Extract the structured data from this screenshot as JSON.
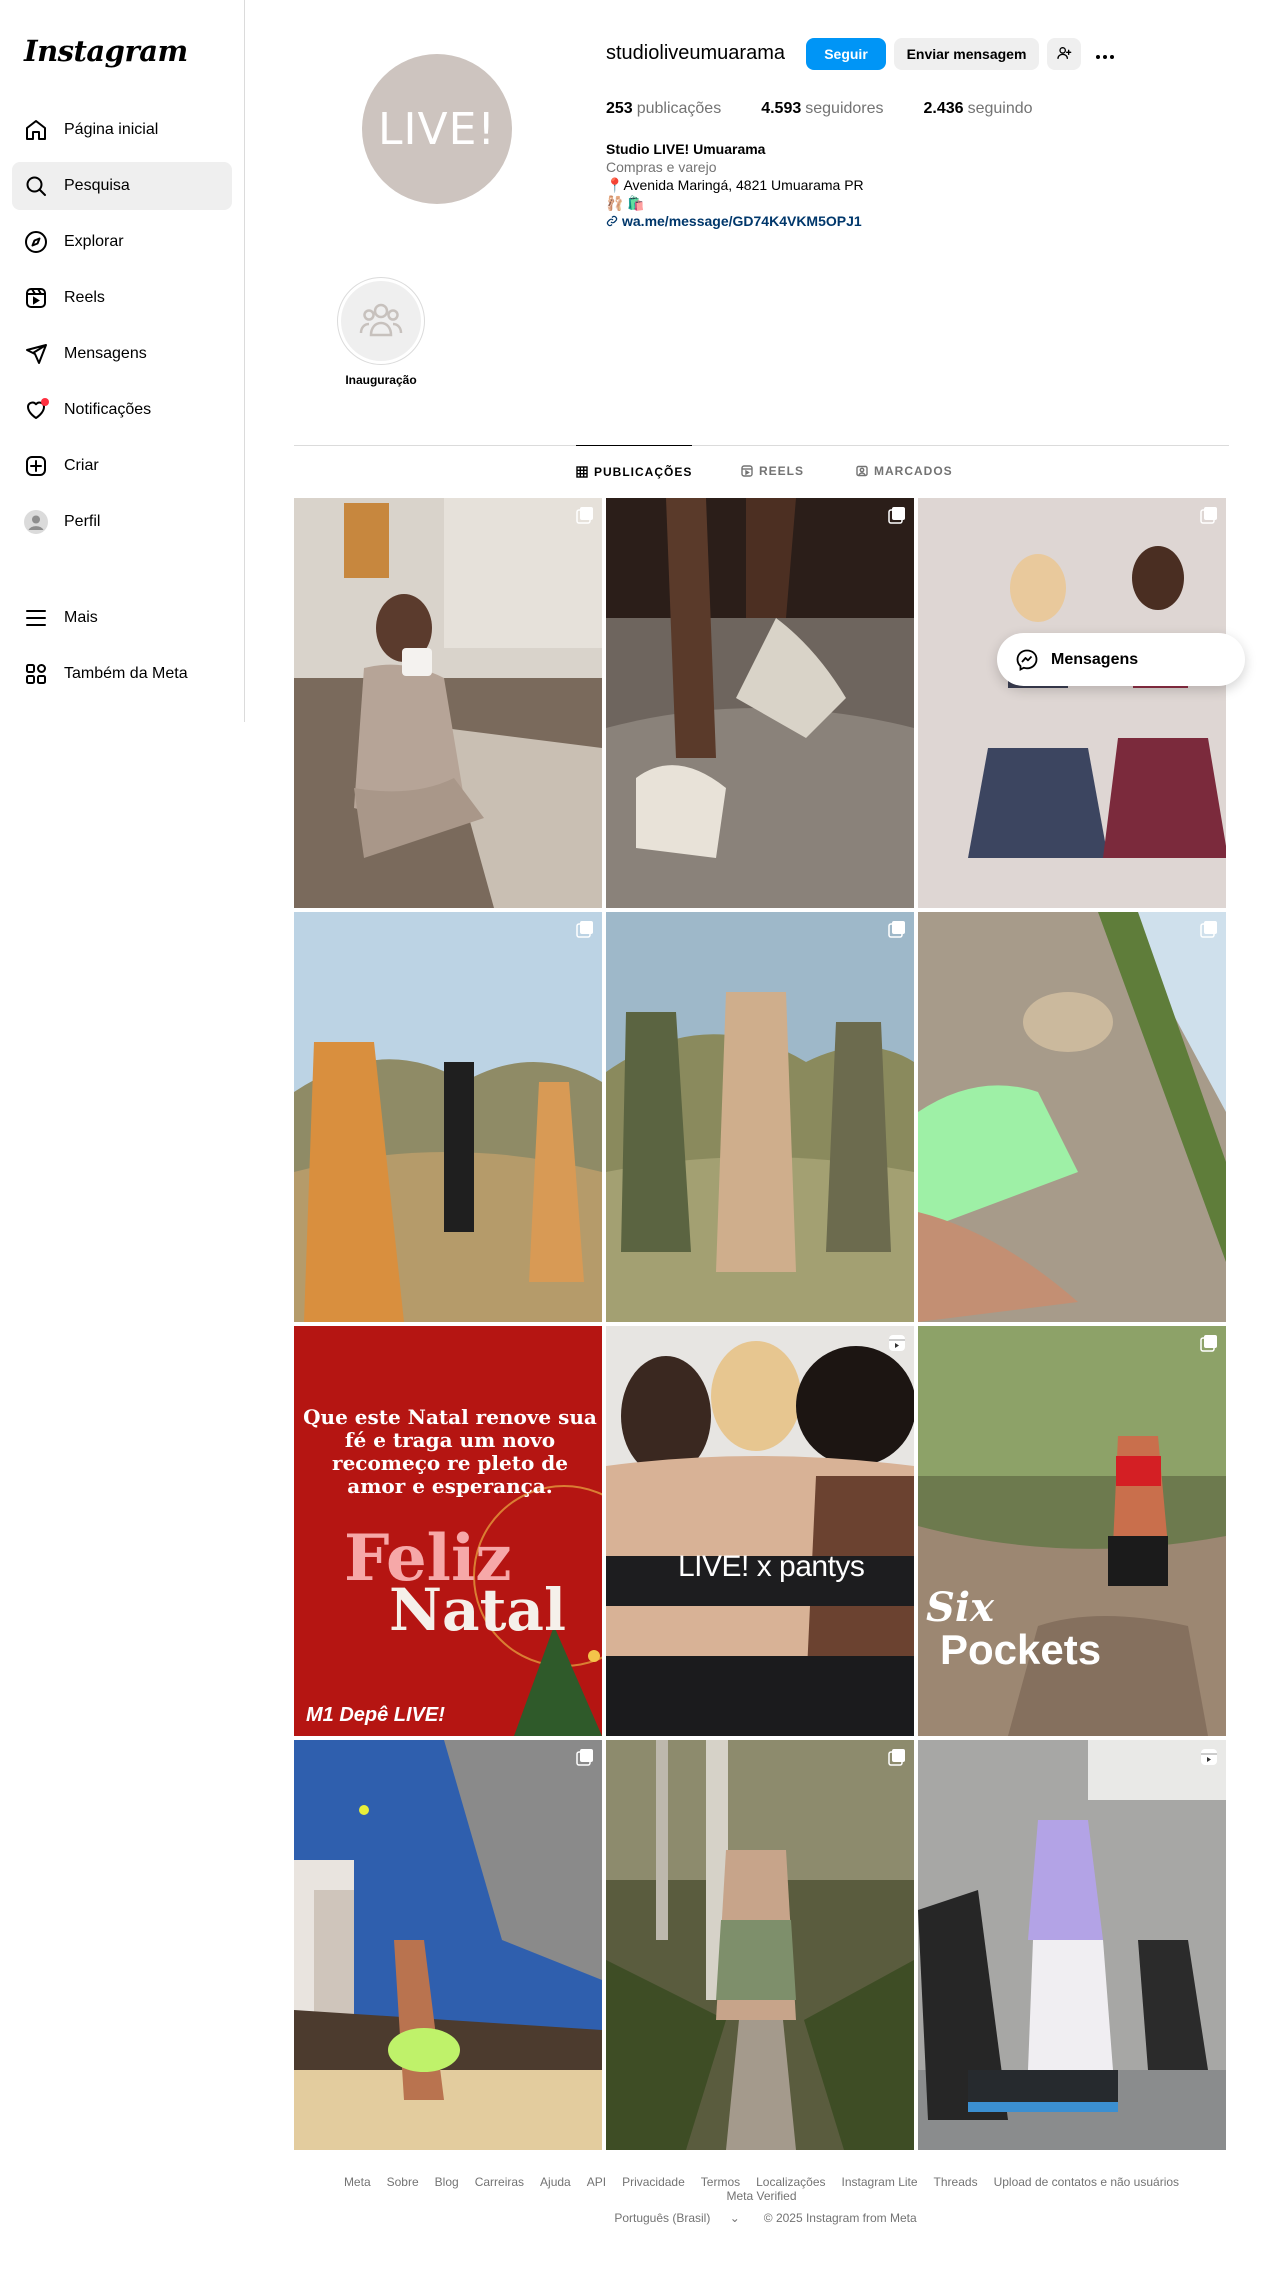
{
  "app": {
    "logo": "Instagram"
  },
  "sidebar": {
    "items": [
      {
        "label": "Página inicial",
        "icon": "home-icon"
      },
      {
        "label": "Pesquisa",
        "icon": "search-icon",
        "active": true
      },
      {
        "label": "Explorar",
        "icon": "compass-icon"
      },
      {
        "label": "Reels",
        "icon": "reels-icon"
      },
      {
        "label": "Mensagens",
        "icon": "send-icon"
      },
      {
        "label": "Notificações",
        "icon": "heart-icon"
      },
      {
        "label": "Criar",
        "icon": "plus-square-icon"
      },
      {
        "label": "Perfil",
        "icon": "profile-avatar"
      }
    ],
    "more": [
      {
        "label": "Mais",
        "icon": "menu-icon"
      },
      {
        "label": "Também da Meta",
        "icon": "meta-apps-icon"
      }
    ]
  },
  "profile": {
    "avatar_text": "LIVE!",
    "username": "studioliveumuarama",
    "follow_label": "Seguir",
    "message_label": "Enviar mensagem",
    "stats": {
      "posts_count": "253",
      "posts_label": "publicações",
      "followers_count": "4.593",
      "followers_label": "seguidores",
      "following_count": "2.436",
      "following_label": "seguindo"
    },
    "bio": {
      "name": "Studio LIVE! Umuarama",
      "category": "Compras e varejo",
      "address": "Avenida Maringá, 4821 Umuarama PR",
      "emoji_line": "🩰 🛍️",
      "link": "wa.me/message/GD74K4VKM5OPJ1"
    }
  },
  "highlights": [
    {
      "label": "Inauguração"
    }
  ],
  "tabs": [
    {
      "label": "PUBLICAÇÕES",
      "active": true
    },
    {
      "label": "REELS"
    },
    {
      "label": "MARCADOS"
    }
  ],
  "posts": [
    {
      "badge": "carousel-icon"
    },
    {
      "badge": "carousel-icon"
    },
    {
      "badge": "carousel-icon"
    },
    {
      "badge": "carousel-icon"
    },
    {
      "badge": "carousel-icon"
    },
    {
      "badge": "carousel-icon"
    },
    {
      "caption": "Que este Natal renove sua fé e traga um novo recomeço re pleto de amor e esperança.",
      "feliz": "Feliz",
      "natal": "Natal",
      "brands": "M1  Depê  LIVE!"
    },
    {
      "badge": "reel-icon",
      "caption": "LIVE! x pantys"
    },
    {
      "badge": "carousel-icon",
      "caption_line1": "Six",
      "caption_line2": "Pockets"
    },
    {
      "badge": "carousel-icon"
    },
    {
      "badge": "carousel-icon"
    },
    {
      "badge": "reel-icon"
    }
  ],
  "floating_messages": {
    "label": "Mensagens"
  },
  "footer": {
    "links": [
      "Meta",
      "Sobre",
      "Blog",
      "Carreiras",
      "Ajuda",
      "API",
      "Privacidade",
      "Termos",
      "Localizações",
      "Instagram Lite",
      "Threads",
      "Upload de contatos e não usuários",
      "Meta Verified"
    ],
    "language": "Português (Brasil)",
    "copyright": "© 2025 Instagram from Meta"
  }
}
